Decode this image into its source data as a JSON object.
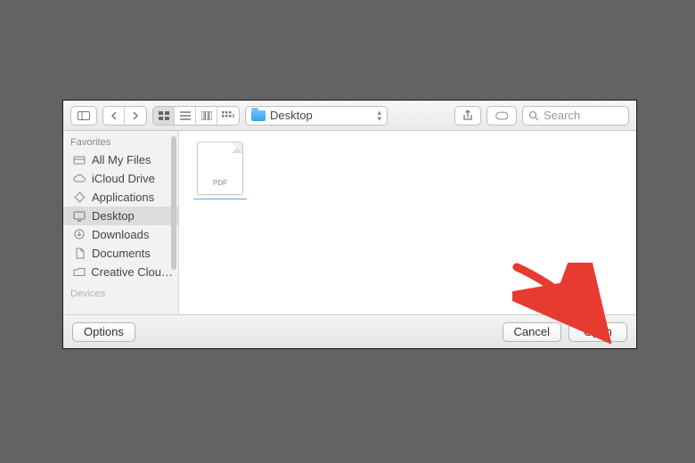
{
  "toolbar": {
    "path_label": "Desktop",
    "search_placeholder": "Search"
  },
  "sidebar": {
    "sections": {
      "favorites_label": "Favorites",
      "devices_label": "Devices"
    },
    "items": [
      {
        "label": "All My Files"
      },
      {
        "label": "iCloud Drive"
      },
      {
        "label": "Applications"
      },
      {
        "label": "Desktop"
      },
      {
        "label": "Downloads"
      },
      {
        "label": "Documents"
      },
      {
        "label": "Creative Clou…"
      }
    ]
  },
  "content": {
    "files": [
      {
        "type_label": "PDF"
      }
    ]
  },
  "footer": {
    "options_label": "Options",
    "cancel_label": "Cancel",
    "open_label": "Open"
  },
  "annotation": {
    "arrow_color": "#e63b2e"
  }
}
